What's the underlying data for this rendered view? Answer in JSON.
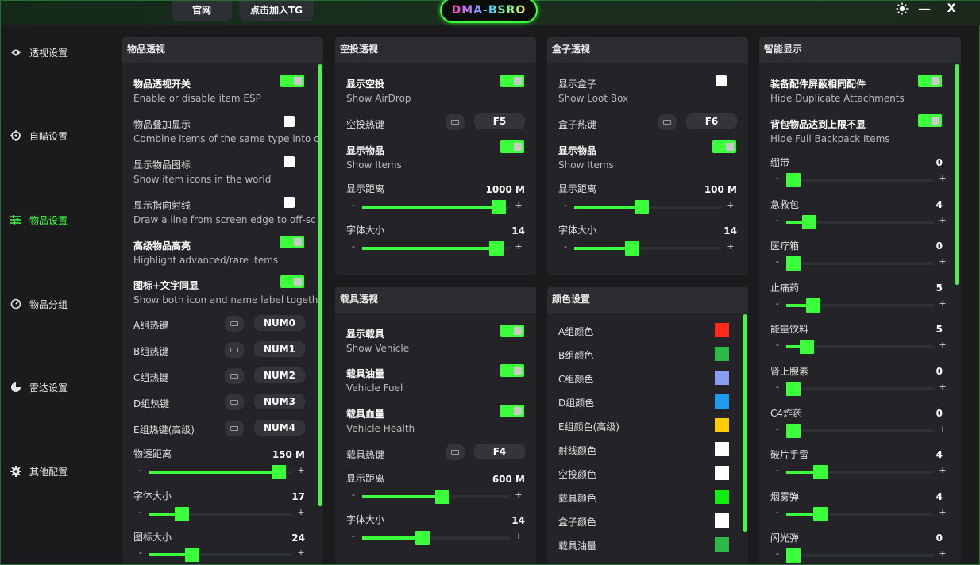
{
  "topbar": {
    "btn_official": "官网",
    "btn_tg": "点击加入TG",
    "logo": "DMA-BSRO",
    "minimize": "—",
    "close": "X"
  },
  "sidebar": {
    "items": [
      {
        "label": "透视设置",
        "icon": "eye-icon"
      },
      {
        "label": "自瞄设置",
        "icon": "crosshair-icon"
      },
      {
        "label": "物品设置",
        "icon": "sliders-icon"
      },
      {
        "label": "物品分组",
        "icon": "gauge-icon"
      },
      {
        "label": "雷达设置",
        "icon": "radar-icon"
      },
      {
        "label": "其他配置",
        "icon": "gear-icon"
      }
    ]
  },
  "item_esp": {
    "title": "物品透视",
    "toggles": [
      {
        "title": "物品透视开关",
        "desc": "Enable or disable item ESP",
        "on": true
      },
      {
        "title": "物品叠加显示",
        "desc": "Combine items of the same type into c",
        "on": false
      },
      {
        "title": "显示物品图标",
        "desc": "Show item icons in the world",
        "on": false
      },
      {
        "title": "显示指向射线",
        "desc": "Draw a line from screen edge to off-sc",
        "on": false
      },
      {
        "title": "高级物品高亮",
        "desc": "Highlight advanced/rare items",
        "on": true
      },
      {
        "title": "图标+文字同显",
        "desc": "Show both icon and name label togeth",
        "on": true
      }
    ],
    "hotkeys": [
      {
        "label": "A组热键",
        "key": "NUM0"
      },
      {
        "label": "B组热键",
        "key": "NUM1"
      },
      {
        "label": "C组热键",
        "key": "NUM2"
      },
      {
        "label": "D组热键",
        "key": "NUM3"
      },
      {
        "label": "E组热键(高级)",
        "key": "NUM4"
      }
    ],
    "sliders": [
      {
        "label": "物透距离",
        "value": "150 M",
        "fraction": 0.95
      },
      {
        "label": "字体大小",
        "value": "17",
        "fraction": 0.2
      },
      {
        "label": "图标大小",
        "value": "24",
        "fraction": 0.28
      }
    ]
  },
  "airdrop": {
    "title": "空投透视",
    "show": {
      "title": "显示空投",
      "desc": "Show AirDrop",
      "on": true
    },
    "hotkey_label": "空投热键",
    "hotkey": "F5",
    "items": {
      "title": "显示物品",
      "desc": "Show Items",
      "on": true
    },
    "dist_label": "显示距离",
    "dist_value": "1000 M",
    "dist_fraction": 0.97,
    "font_label": "字体大小",
    "font_value": "14",
    "font_fraction": 0.95
  },
  "vehicle": {
    "title": "载具透视",
    "toggles": [
      {
        "title": "显示载具",
        "desc": "Show Vehicle",
        "on": true
      },
      {
        "title": "载具油量",
        "desc": "Vehicle Fuel",
        "on": true
      },
      {
        "title": "载具血量",
        "desc": "Vehicle Health",
        "on": true
      }
    ],
    "hotkey_label": "载具热键",
    "hotkey": "F4",
    "dist_label": "显示距离",
    "dist_value": "600 M",
    "dist_fraction": 0.55,
    "font_label": "字体大小",
    "font_value": "14",
    "font_fraction": 0.4
  },
  "box": {
    "title": "盒子透视",
    "show": {
      "title": "显示盒子",
      "desc": "Show Loot Box",
      "on": false
    },
    "hotkey_label": "盒子热键",
    "hotkey": "F6",
    "items": {
      "title": "显示物品",
      "desc": "Show Items",
      "on": true
    },
    "dist_label": "显示距离",
    "dist_value": "100 M",
    "dist_fraction": 0.45,
    "font_label": "字体大小",
    "font_value": "14",
    "font_fraction": 0.38
  },
  "colors": {
    "title": "颜色设置",
    "items": [
      {
        "label": "A组颜色",
        "color": "#ff2a1a"
      },
      {
        "label": "B组颜色",
        "color": "#2fb84a"
      },
      {
        "label": "C组颜色",
        "color": "#8a9cf0"
      },
      {
        "label": "D组颜色",
        "color": "#1e9bf0"
      },
      {
        "label": "E组颜色(高级)",
        "color": "#ffcc00"
      },
      {
        "label": "射线颜色",
        "color": "#ffffff"
      },
      {
        "label": "空投颜色",
        "color": "#ffffff"
      },
      {
        "label": "载具颜色",
        "color": "#11ee11"
      },
      {
        "label": "盒子颜色",
        "color": "#ffffff"
      },
      {
        "label": "载具油量",
        "color": "#2fb84a"
      }
    ]
  },
  "smart": {
    "title": "智能显示",
    "toggles": [
      {
        "title": "装备配件屏蔽相同配件",
        "desc": "Hide Duplicate Attachments",
        "on": true
      },
      {
        "title": "背包物品达到上限不显",
        "desc": "Hide Full Backpack Items",
        "on": true
      }
    ],
    "sliders": [
      {
        "label": "绷带",
        "value": "0",
        "fraction": 0.0
      },
      {
        "label": "急救包",
        "value": "4",
        "fraction": 0.12
      },
      {
        "label": "医疗箱",
        "value": "0",
        "fraction": 0.0
      },
      {
        "label": "止痛药",
        "value": "5",
        "fraction": 0.15
      },
      {
        "label": "能量饮料",
        "value": "5",
        "fraction": 0.1
      },
      {
        "label": "肾上腺素",
        "value": "0",
        "fraction": 0.0
      },
      {
        "label": "C4炸药",
        "value": "0",
        "fraction": 0.0
      },
      {
        "label": "破片手雷",
        "value": "4",
        "fraction": 0.2
      },
      {
        "label": "烟雾弹",
        "value": "4",
        "fraction": 0.2
      },
      {
        "label": "闪光弹",
        "value": "0",
        "fraction": 0.0
      }
    ]
  },
  "theme": {
    "accent": "#3cff3c",
    "panel_bg": "#242428",
    "header_bg": "#2c2d31"
  }
}
